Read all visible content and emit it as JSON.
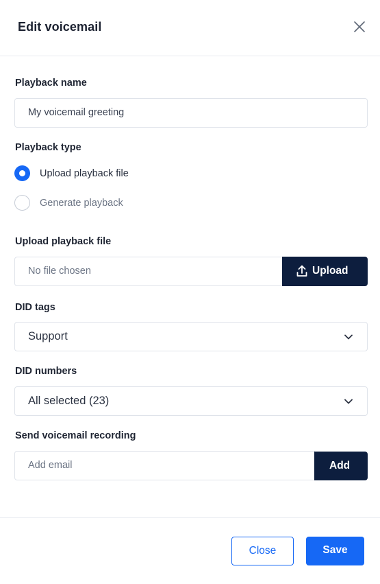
{
  "dialog": {
    "title": "Edit voicemail",
    "close_icon": "close-icon"
  },
  "playback_name": {
    "label": "Playback name",
    "value": "My voicemail greeting"
  },
  "playback_type": {
    "label": "Playback type",
    "options": [
      {
        "label": "Upload playback file",
        "selected": true
      },
      {
        "label": "Generate playback",
        "selected": false
      }
    ]
  },
  "upload": {
    "label": "Upload playback file",
    "file_status": "No file chosen",
    "button_label": "Upload",
    "button_icon": "upload-icon"
  },
  "did_tags": {
    "label": "DID tags",
    "selected": "Support",
    "icon": "chevron-down-icon"
  },
  "did_numbers": {
    "label": "DID numbers",
    "selected": "All selected (23)",
    "icon": "chevron-down-icon"
  },
  "send_recording": {
    "label": "Send voicemail recording",
    "placeholder": "Add email",
    "button_label": "Add"
  },
  "footer": {
    "close_label": "Close",
    "save_label": "Save"
  },
  "colors": {
    "primary": "#1668f5",
    "dark_button": "#0d1e3e",
    "border": "#dfe3ea"
  }
}
